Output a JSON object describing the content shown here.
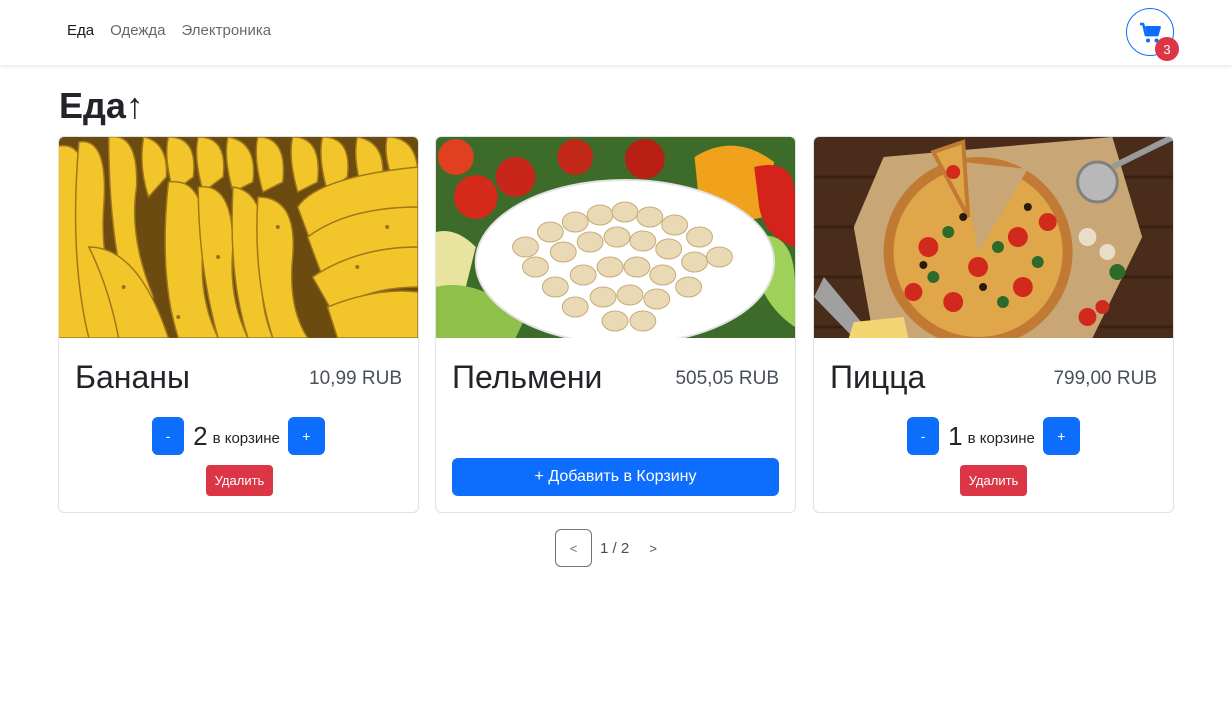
{
  "nav": {
    "links": [
      {
        "label": "Еда"
      },
      {
        "label": "Одежда"
      },
      {
        "label": "Электроника"
      }
    ],
    "cart_count": "3",
    "cart_icon": "shopping-cart-icon",
    "accent": "#0d6efd"
  },
  "page_title": "Еда↑",
  "products": [
    {
      "name": "Бананы",
      "price": "10,99 RUB",
      "qty": "2",
      "in_cart_label": "в корзине",
      "minus": "-",
      "plus": "+",
      "remove": "Удалить"
    },
    {
      "name": "Пельмени",
      "price": "505,05 RUB",
      "add_label": "+ Добавить в Корзину"
    },
    {
      "name": "Пицца",
      "price": "799,00 RUB",
      "qty": "1",
      "in_cart_label": "в корзине",
      "minus": "-",
      "plus": "+",
      "remove": "Удалить"
    }
  ],
  "pagination": {
    "prev": "<",
    "info": "1 / 2",
    "next": ">"
  },
  "colors": {
    "primary": "#0d6efd",
    "danger": "#dc3545"
  }
}
